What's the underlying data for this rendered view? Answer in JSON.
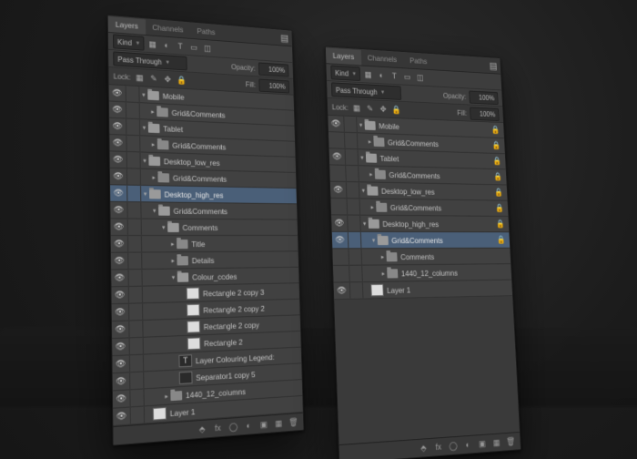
{
  "tabs": {
    "layers": "Layers",
    "channels": "Channels",
    "paths": "Paths"
  },
  "toolbar": {
    "kind": "Kind",
    "opacity": "Opacity:",
    "opacity_val": "100%",
    "fill": "Fill:",
    "fill_val": "100%",
    "blend": "Pass Through",
    "lock": "Lock:"
  },
  "panelA": {
    "rows": [
      {
        "d": 0,
        "vis": 1,
        "arr": "▾",
        "ic": "fold open",
        "name": "Mobile"
      },
      {
        "d": 1,
        "vis": 1,
        "arr": "▸",
        "ic": "fold",
        "name": "Grid&Comments"
      },
      {
        "d": 0,
        "vis": 1,
        "arr": "▾",
        "ic": "fold open",
        "name": "Tablet"
      },
      {
        "d": 1,
        "vis": 1,
        "arr": "▸",
        "ic": "fold",
        "name": "Grid&Comments"
      },
      {
        "d": 0,
        "vis": 1,
        "arr": "▾",
        "ic": "fold open",
        "name": "Desktop_low_res"
      },
      {
        "d": 1,
        "vis": 1,
        "arr": "▸",
        "ic": "fold",
        "name": "Grid&Comments"
      },
      {
        "d": 0,
        "vis": 1,
        "arr": "▾",
        "ic": "fold open",
        "name": "Desktop_high_res",
        "sel": 1
      },
      {
        "d": 1,
        "vis": 1,
        "arr": "▾",
        "ic": "fold open",
        "name": "Grid&Comments"
      },
      {
        "d": 2,
        "vis": 1,
        "arr": "▾",
        "ic": "fold open",
        "name": "Comments"
      },
      {
        "d": 3,
        "vis": 1,
        "arr": "▸",
        "ic": "fold",
        "name": "Title"
      },
      {
        "d": 3,
        "vis": 1,
        "arr": "▸",
        "ic": "fold",
        "name": "Details"
      },
      {
        "d": 3,
        "vis": 1,
        "arr": "▾",
        "ic": "fold open",
        "name": "Colour_codes"
      },
      {
        "d": 4,
        "vis": 1,
        "arr": "",
        "ic": "thumb",
        "name": "Rectangle 2 copy 3"
      },
      {
        "d": 4,
        "vis": 1,
        "arr": "",
        "ic": "thumb",
        "name": "Rectangle 2 copy 2"
      },
      {
        "d": 4,
        "vis": 1,
        "arr": "",
        "ic": "thumb",
        "name": "Rectangle 2 copy"
      },
      {
        "d": 4,
        "vis": 1,
        "arr": "",
        "ic": "thumb",
        "name": "Rectangle 2"
      },
      {
        "d": 3,
        "vis": 1,
        "arr": "",
        "ic": "T",
        "name": "Layer Colouring Legend:"
      },
      {
        "d": 3,
        "vis": 1,
        "arr": "",
        "ic": "thumb dark",
        "name": "Separator1 copy 5"
      },
      {
        "d": 2,
        "vis": 1,
        "arr": "▸",
        "ic": "fold",
        "name": "1440_12_columns"
      },
      {
        "d": 0,
        "vis": 1,
        "arr": "",
        "ic": "thumb",
        "name": "Layer 1"
      }
    ]
  },
  "panelB": {
    "rows": [
      {
        "d": 0,
        "vis": 1,
        "arr": "▾",
        "ic": "fold open",
        "name": "Mobile",
        "lock": 1
      },
      {
        "d": 1,
        "vis": 0,
        "arr": "▸",
        "ic": "fold",
        "name": "Grid&Comments",
        "lock": 1
      },
      {
        "d": 0,
        "vis": 1,
        "arr": "▾",
        "ic": "fold open",
        "name": "Tablet",
        "lock": 1
      },
      {
        "d": 1,
        "vis": 0,
        "arr": "▸",
        "ic": "fold",
        "name": "Grid&Comments",
        "lock": 1
      },
      {
        "d": 0,
        "vis": 1,
        "arr": "▾",
        "ic": "fold open",
        "name": "Desktop_low_res",
        "lock": 1
      },
      {
        "d": 1,
        "vis": 0,
        "arr": "▸",
        "ic": "fold",
        "name": "Grid&Comments",
        "lock": 1
      },
      {
        "d": 0,
        "vis": 1,
        "arr": "▾",
        "ic": "fold open",
        "name": "Desktop_high_res",
        "lock": 1
      },
      {
        "d": 1,
        "vis": 1,
        "arr": "▾",
        "ic": "fold open",
        "name": "Grid&Comments",
        "sel": 1,
        "lock": 1
      },
      {
        "d": 2,
        "vis": 0,
        "arr": "▸",
        "ic": "fold",
        "name": "Comments"
      },
      {
        "d": 2,
        "vis": 0,
        "arr": "▸",
        "ic": "fold",
        "name": "1440_12_columns"
      },
      {
        "d": 0,
        "vis": 1,
        "arr": "",
        "ic": "thumb",
        "name": "Layer 1"
      }
    ]
  }
}
